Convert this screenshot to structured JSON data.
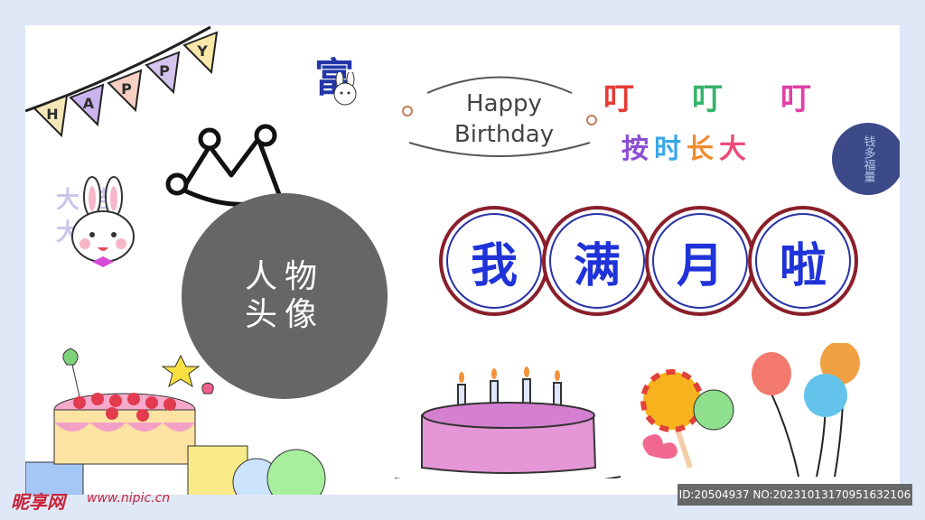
{
  "banner": {
    "letters": [
      "H",
      "A",
      "P",
      "P",
      "Y"
    ],
    "colors": [
      "#f6e7b9",
      "#c9b3ee",
      "#f7d0c3",
      "#d5c5ee",
      "#f8e8a9"
    ]
  },
  "avatar": {
    "line1": "人物",
    "line2": "头像"
  },
  "happy_birthday": {
    "line1": "Happy",
    "line2": "Birthday"
  },
  "ding": {
    "text": [
      "叮",
      "叮",
      "叮"
    ],
    "colors": [
      "#e63b35",
      "#37b36a",
      "#e03fa8"
    ]
  },
  "grow": {
    "chars": [
      "按",
      "时",
      "长",
      "大"
    ],
    "colors": [
      "#8b4fd3",
      "#3aa6e8",
      "#f08b2e",
      "#ef4a7a"
    ]
  },
  "main_title": {
    "chars": [
      "我",
      "满",
      "月",
      "啦"
    ]
  },
  "side_text_left": "大吉大利",
  "badge_text": "钱多福量",
  "palace_char": "富",
  "watermark": {
    "site": "昵享网",
    "url": "www.nipic.cn",
    "id": "ID:20504937 NO:20231013170951632106"
  }
}
